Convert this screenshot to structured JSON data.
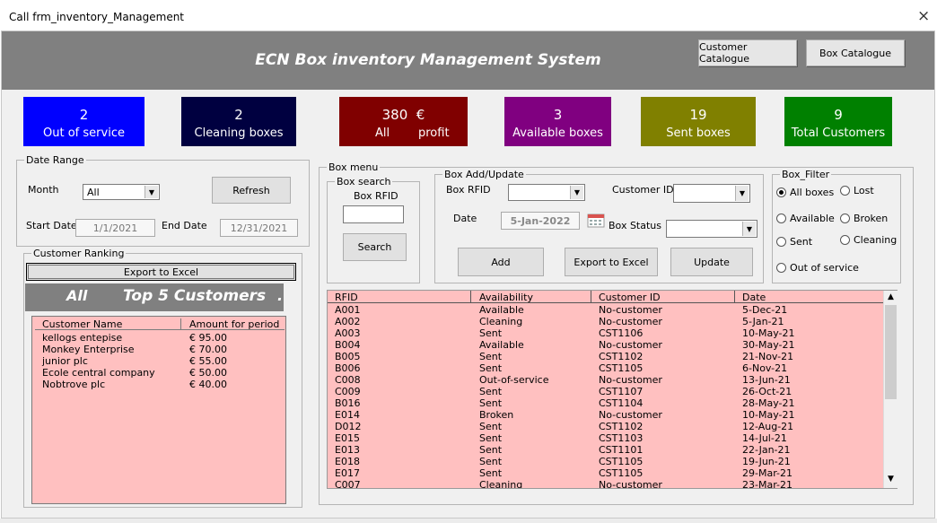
{
  "window": {
    "title": "Call frm_inventory_Management",
    "close": "×"
  },
  "header": {
    "title": "ECN Box inventory Management System",
    "customer_catalogue": "Customer Catalogue",
    "box_catalogue": "Box Catalogue"
  },
  "tiles": {
    "out_of_service": {
      "num": "2",
      "label": "Out of service",
      "color": "#0000ff"
    },
    "cleaning": {
      "num": "2",
      "label": "Cleaning boxes",
      "color": "#000040"
    },
    "profit": {
      "num": "380  €",
      "label_left": "All",
      "label_right": "profit",
      "color": "#800000"
    },
    "available": {
      "num": "3",
      "label": "Available boxes",
      "color": "#800080"
    },
    "sent": {
      "num": "19",
      "label": "Sent boxes",
      "color": "#808000"
    },
    "customers": {
      "num": "9",
      "label": "Total Customers",
      "color": "#008000"
    }
  },
  "date_range": {
    "legend": "Date Range",
    "month_label": "Month",
    "month_value": "All",
    "refresh": "Refresh",
    "start_label": "Start Date",
    "start_value": "1/1/2021",
    "end_label": "End  Date",
    "end_value": "12/31/2021"
  },
  "ranking": {
    "legend": "Customer Ranking",
    "export": "Export to Excel",
    "banner_left": "All",
    "banner_right": "Top 5 Customers",
    "banner_dot": ".",
    "col_name": "Customer Name",
    "col_amount": "Amount for period",
    "rows": [
      {
        "name": "kellogs entepise",
        "amount": "€ 95.00"
      },
      {
        "name": "Monkey Enterprise",
        "amount": "€ 70.00"
      },
      {
        "name": "junior plc",
        "amount": "€ 55.00"
      },
      {
        "name": "Ecole central company",
        "amount": "€ 50.00"
      },
      {
        "name": "Nobtrove plc",
        "amount": "€ 40.00"
      }
    ]
  },
  "box_menu": {
    "legend": "Box menu",
    "search": {
      "legend": "Box search",
      "rfid_label": "Box RFID",
      "button": "Search"
    },
    "add_update": {
      "legend": "Box Add/Update",
      "rfid_label": "Box RFID",
      "customer_label": "Customer ID",
      "date_label": "Date",
      "date_value": "5-Jan-2022",
      "status_label": "Box Status",
      "add": "Add",
      "export": "Export to Excel",
      "update": "Update"
    },
    "filter": {
      "legend": "Box_Filter",
      "all": "All boxes",
      "lost": "Lost",
      "available": "Available",
      "broken": "Broken",
      "sent": "Sent",
      "cleaning": "Cleaning",
      "out_of_service": "Out of service"
    }
  },
  "box_table": {
    "headers": [
      "RFID",
      "Availability",
      "Customer ID",
      "Date"
    ],
    "rows": [
      [
        "A001",
        "Available",
        "No-customer",
        "5-Dec-21"
      ],
      [
        "A002",
        "Cleaning",
        "No-customer",
        "5-Jan-21"
      ],
      [
        "A003",
        "Sent",
        "CST1106",
        "10-May-21"
      ],
      [
        "B004",
        "Available",
        "No-customer",
        "30-May-21"
      ],
      [
        "B005",
        "Sent",
        "CST1102",
        "21-Nov-21"
      ],
      [
        "B006",
        "Sent",
        "CST1105",
        "6-Nov-21"
      ],
      [
        "C008",
        "Out-of-service",
        "No-customer",
        "13-Jun-21"
      ],
      [
        "C009",
        "Sent",
        "CST1107",
        "26-Oct-21"
      ],
      [
        "B016",
        "Sent",
        "CST1104",
        "28-May-21"
      ],
      [
        "E014",
        "Broken",
        "No-customer",
        "10-May-21"
      ],
      [
        "D012",
        "Sent",
        "CST1102",
        "12-Aug-21"
      ],
      [
        "E015",
        "Sent",
        "CST1103",
        "14-Jul-21"
      ],
      [
        "E013",
        "Sent",
        "CST1101",
        "22-Jan-21"
      ],
      [
        "E018",
        "Sent",
        "CST1105",
        "19-Jun-21"
      ],
      [
        "E017",
        "Sent",
        "CST1105",
        "29-Mar-21"
      ],
      [
        "C007",
        "Cleaning",
        "No-customer",
        "23-Mar-21"
      ]
    ]
  }
}
